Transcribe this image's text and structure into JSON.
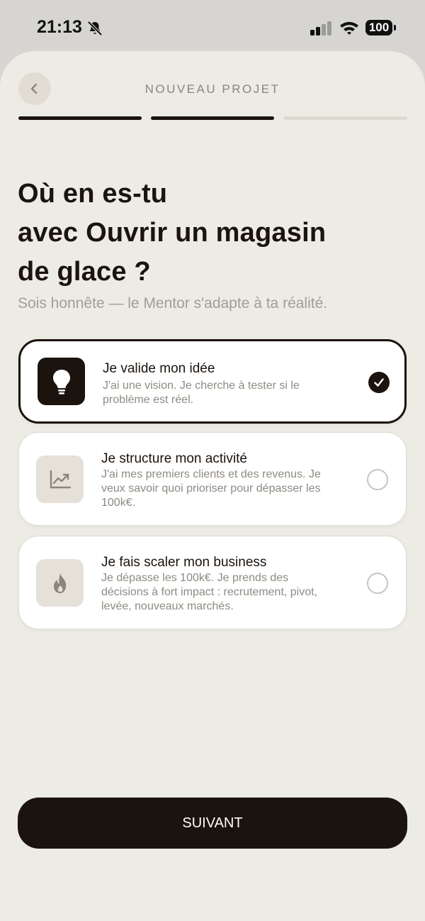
{
  "status_bar": {
    "time": "21:13",
    "battery": "100"
  },
  "header": {
    "title": "NOUVEAU PROJET"
  },
  "progress": {
    "current_step": 2,
    "total_steps": 3
  },
  "question": {
    "headline": "Où en es-tu\navec Ouvrir un magasin\nde glace  ?",
    "subtitle": "Sois honnête — le Mentor s'adapte à ta réalité."
  },
  "options": [
    {
      "title": "Je valide mon idée",
      "description": "J'ai une vision. Je cherche à tester si le problème est réel.",
      "icon": "lightbulb-icon",
      "selected": true
    },
    {
      "title": "Je structure mon activité",
      "description": "J'ai mes premiers clients et des revenus. Je veux savoir quoi prioriser pour dépasser les 100k€.",
      "icon": "chart-trend-icon",
      "selected": false
    },
    {
      "title": "Je fais scaler mon business",
      "description": "Je dépasse les 100k€. Je prends des décisions à fort impact : recrutement, pivot, levée, nouveaux marchés.",
      "icon": "flame-icon",
      "selected": false
    }
  ],
  "next_button": {
    "label": "SUIVANT"
  },
  "colors": {
    "primary": "#1b130d",
    "background": "#ecebe4",
    "muted_text": "#a39d95",
    "icon_tile": "#e5e0d8"
  }
}
